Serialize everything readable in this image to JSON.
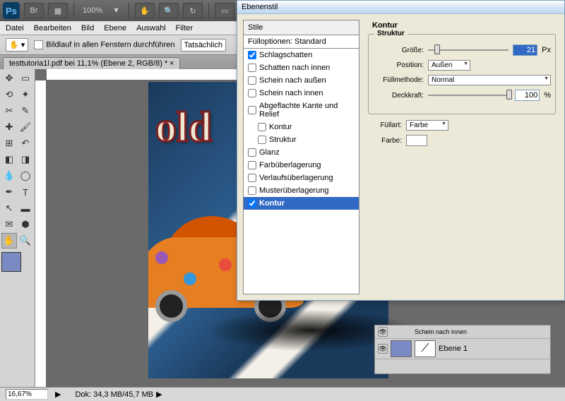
{
  "app": {
    "icon_text": "Ps"
  },
  "toolbar": {
    "zoom": "100%",
    "arrange_items": [
      "Br",
      "▦"
    ]
  },
  "menu": [
    "Datei",
    "Bearbeiten",
    "Bild",
    "Ebene",
    "Auswahl",
    "Filter"
  ],
  "options": {
    "scroll_label": "Bildlauf in allen Fenstern durchführen",
    "actual_label": "Tatsächlich"
  },
  "tab": {
    "label": "testtutoria1l.pdf bei 11,1% (Ebene 2, RGB/8) *"
  },
  "artwork": {
    "text": "old"
  },
  "status": {
    "zoom": "16,67%",
    "doc": "Dok: 34,3 MB/45,7 MB"
  },
  "dialog": {
    "title": "Ebenenstil",
    "styles_header": "Stile",
    "blend_opts": "Fülloptionen: Standard",
    "effects": [
      {
        "label": "Schlagschatten",
        "checked": true
      },
      {
        "label": "Schatten nach innen",
        "checked": false
      },
      {
        "label": "Schein nach außen",
        "checked": false
      },
      {
        "label": "Schein nach innen",
        "checked": false
      },
      {
        "label": "Abgeflachte Kante und Relief",
        "checked": false
      },
      {
        "label": "Kontur",
        "checked": false,
        "sub": true
      },
      {
        "label": "Struktur",
        "checked": false,
        "sub": true
      },
      {
        "label": "Glanz",
        "checked": false
      },
      {
        "label": "Farbüberlagerung",
        "checked": false
      },
      {
        "label": "Verlaufsüberlagerung",
        "checked": false
      },
      {
        "label": "Musterüberlagerung",
        "checked": false
      },
      {
        "label": "Kontur",
        "checked": true,
        "selected": true
      }
    ],
    "panel_title": "Kontur",
    "struct_legend": "Struktur",
    "size_label": "Größe:",
    "size_val": "21",
    "size_unit": "Px",
    "pos_label": "Position:",
    "pos_val": "Außen",
    "blend_label": "Füllmethode:",
    "blend_val": "Normal",
    "opac_label": "Deckkraft:",
    "opac_val": "100",
    "opac_unit": "%",
    "fill_label": "Füllart:",
    "fill_val": "Farbe",
    "color_label": "Farbe:"
  },
  "layers": {
    "item_partial": "Schein nach innen",
    "layer1": "Ebene 1"
  }
}
